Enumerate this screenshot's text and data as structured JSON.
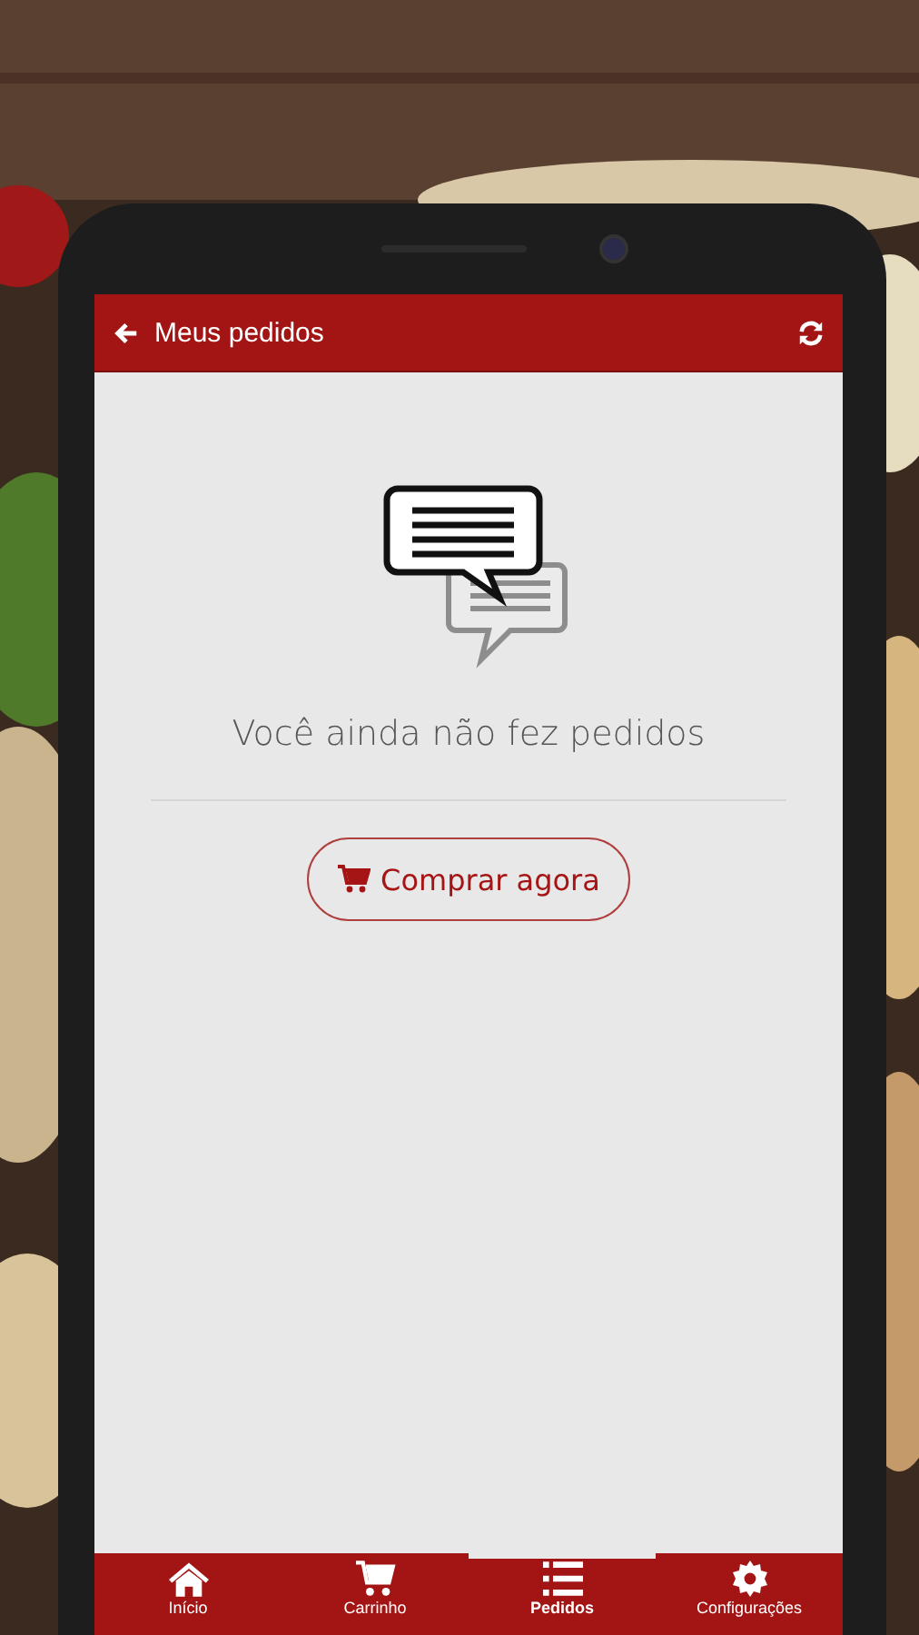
{
  "header": {
    "title": "Meus pedidos"
  },
  "empty_state": {
    "message": "Você ainda não fez pedidos",
    "button": "Comprar agora"
  },
  "bottom_nav": [
    {
      "label": "Início",
      "selected": false
    },
    {
      "label": "Carrinho",
      "selected": false
    },
    {
      "label": "Pedidos",
      "selected": true
    },
    {
      "label": "Configurações",
      "selected": false
    }
  ]
}
